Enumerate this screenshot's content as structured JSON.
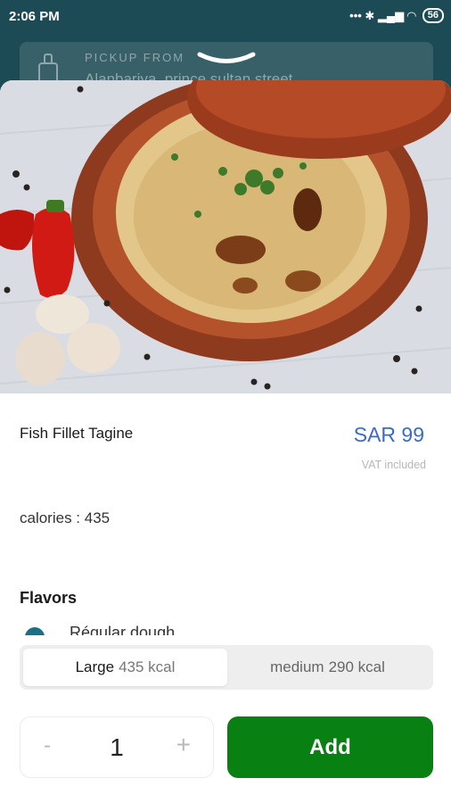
{
  "status_bar": {
    "time": "2:06 PM",
    "signal_icons": "••• ✱ ▂▄▆ ◠",
    "battery": "56"
  },
  "pickup": {
    "label": "PICKUP FROM",
    "address": "Alanbariya, prince sultan street"
  },
  "product": {
    "name": "Fish Fillet Tagine",
    "price": "SAR 99",
    "vat_note": "VAT included",
    "calories_text": "calories : 435"
  },
  "flavors": {
    "title": "Flavors",
    "first_option": "Régular dough"
  },
  "sizes": [
    {
      "name": "Large",
      "kcal": "435 kcal",
      "selected": true
    },
    {
      "name": "medium",
      "kcal": "290 kcal",
      "selected": false
    }
  ],
  "cart": {
    "minus": "-",
    "quantity": "1",
    "plus": "+",
    "add_label": "Add"
  },
  "colors": {
    "header_bg": "#1c4a55",
    "price": "#3a6bc8",
    "add_button": "#088012",
    "radio": "#1c6f85"
  }
}
